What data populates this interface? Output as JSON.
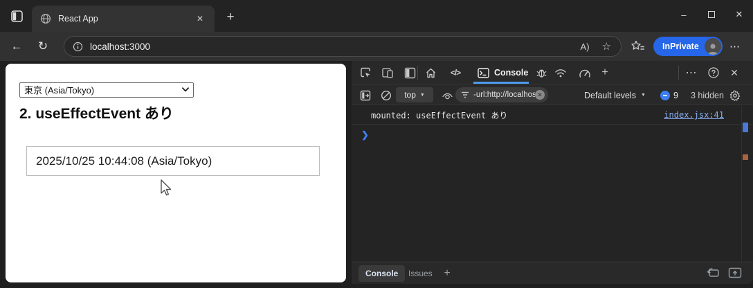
{
  "browser": {
    "tab_title": "React App",
    "url": "localhost:3000",
    "inprivate_label": "InPrivate"
  },
  "icons": {
    "close": "✕",
    "plus": "+",
    "minimize": "–",
    "back": "←",
    "refresh": "↻",
    "more": "⋯",
    "help": "?",
    "code": "</>",
    "read_aloud": "A)",
    "star": "☆",
    "dropdown_arrow": "▼",
    "prompt": "❯",
    "filter_clear": "✕"
  },
  "page": {
    "timezone_select_value": "東京 (Asia/Tokyo)",
    "heading": "2. useEffectEvent あり",
    "datetime_display": "2025/10/25 10:44:08 (Asia/Tokyo)"
  },
  "devtools": {
    "toolbar": {
      "console_tab_label": "Console"
    },
    "filter": {
      "context_selector": "top",
      "filter_value": "-url:http://localhos",
      "levels_label": "Default levels",
      "issues_count": "9",
      "hidden_label": "3 hidden"
    },
    "console": {
      "message": "mounted: useEffectEvent あり",
      "source_link": "index.jsx:41"
    },
    "drawer": {
      "console_tab_label": "Console",
      "issues_tab_label": "Issues"
    }
  },
  "colors": {
    "accent_blue": "#4e9bf0",
    "inprivate_blue": "#2666e8",
    "link_blue": "#86aef2",
    "scroll_mark_orange": "#a9623f"
  }
}
